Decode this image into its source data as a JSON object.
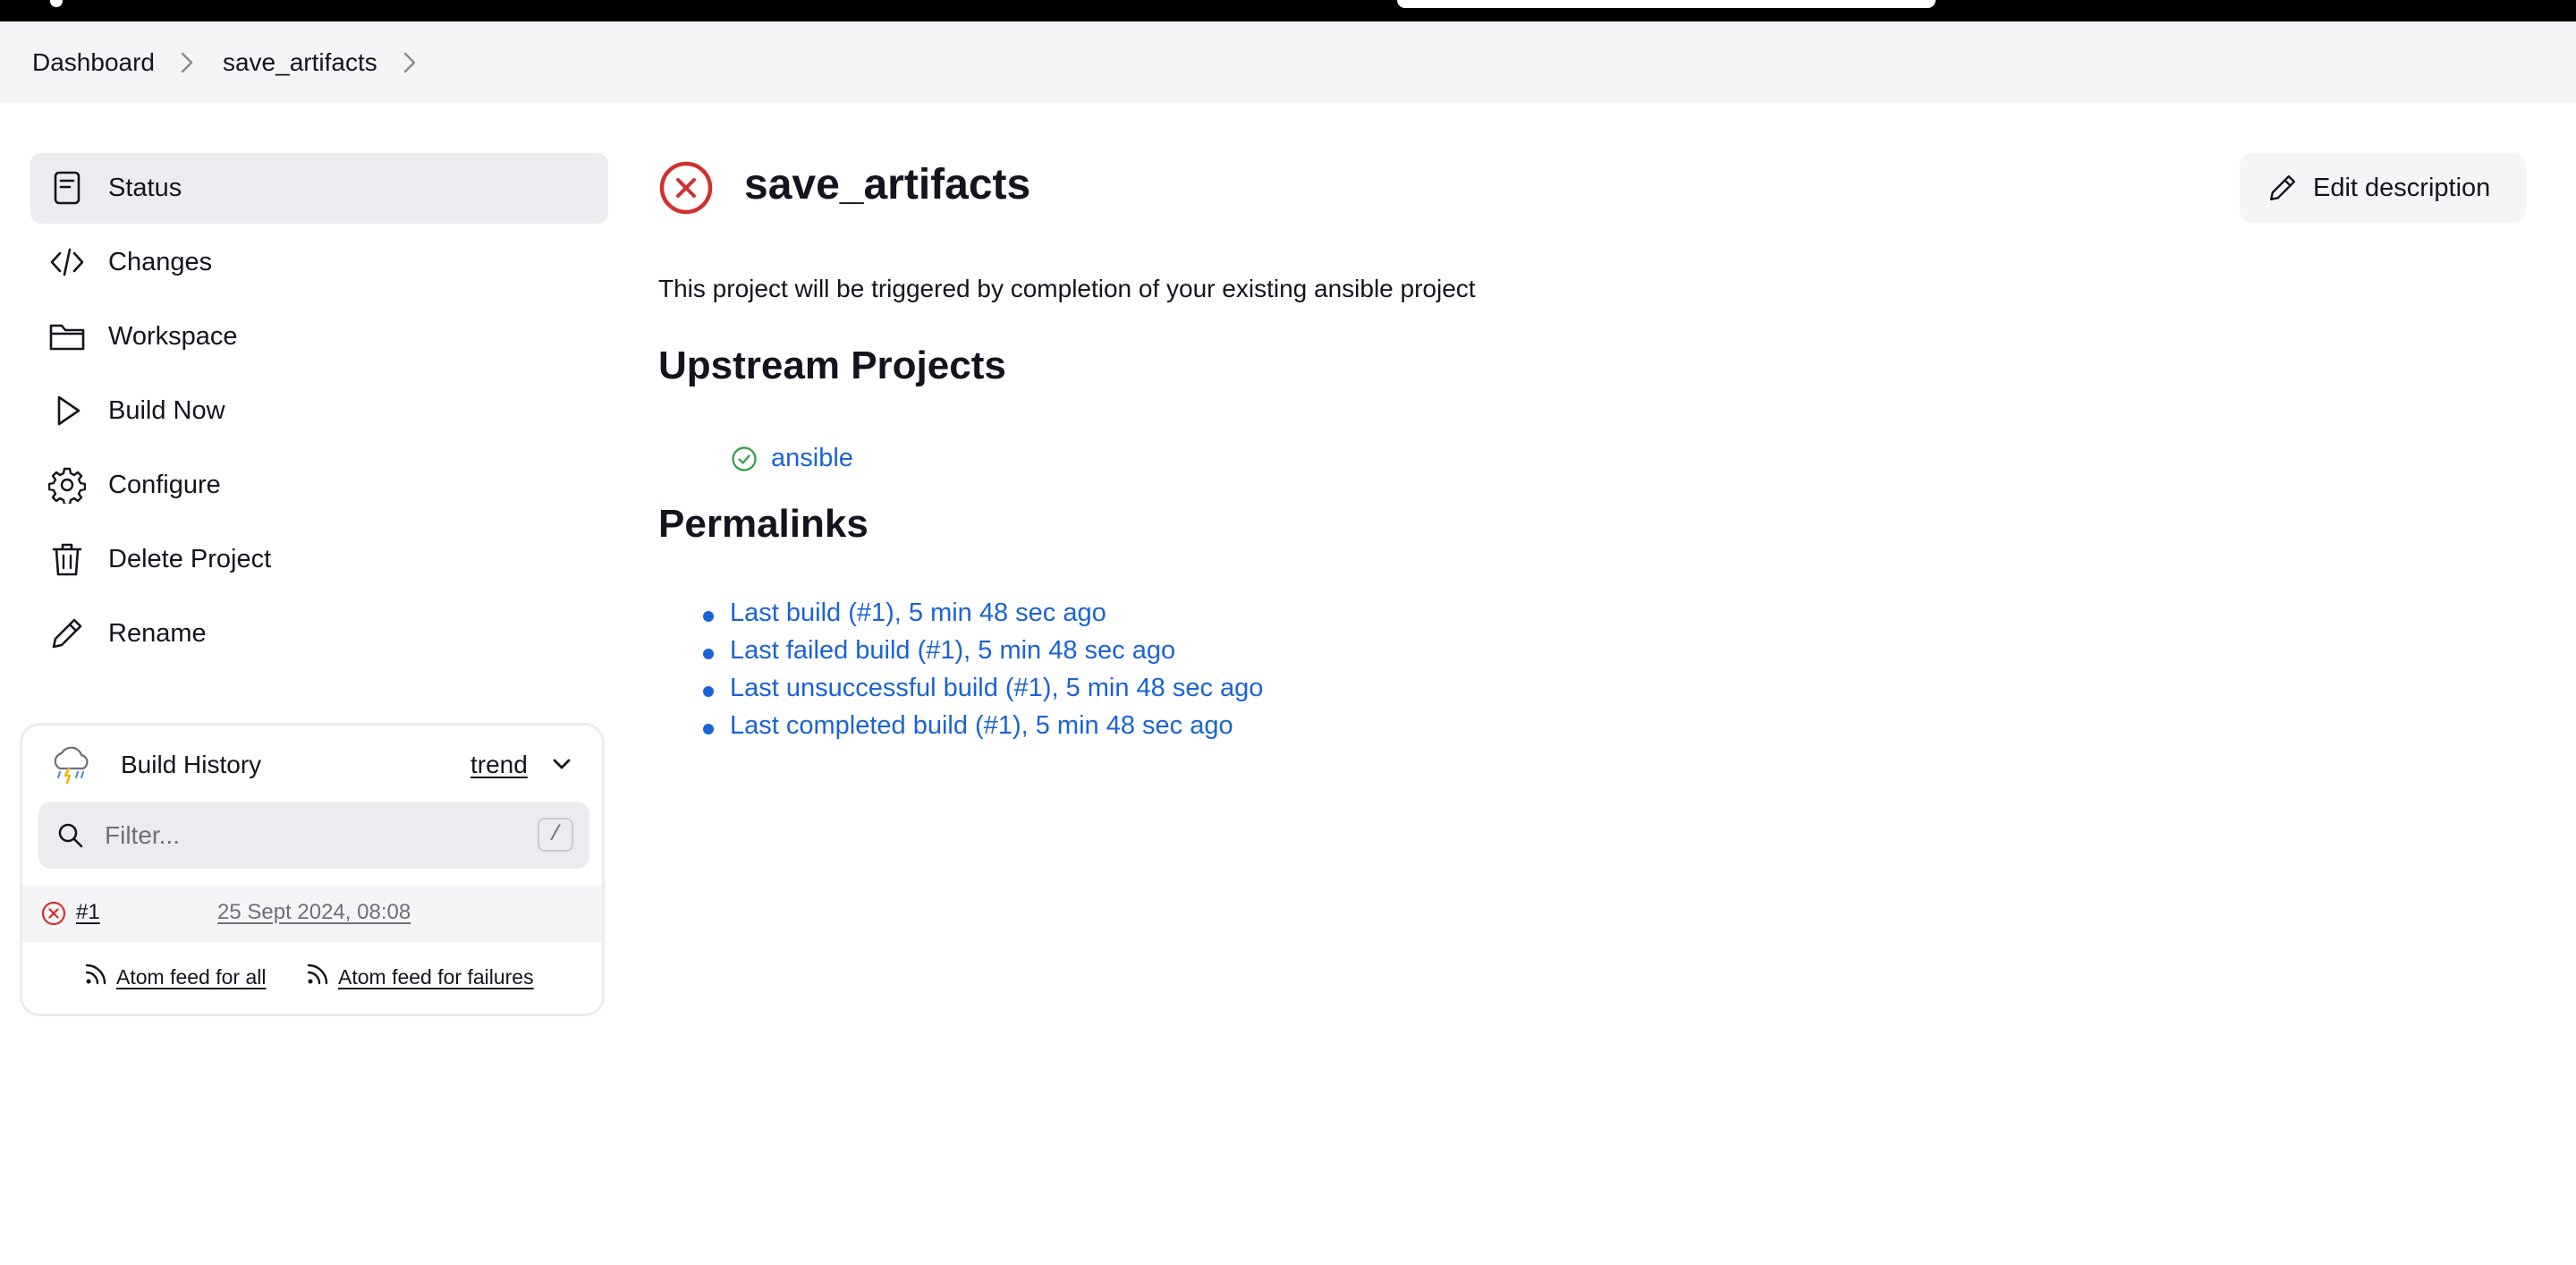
{
  "breadcrumb": {
    "items": [
      "Dashboard",
      "save_artifacts"
    ]
  },
  "sidebar": {
    "items": [
      {
        "label": "Status",
        "icon": "status-icon"
      },
      {
        "label": "Changes",
        "icon": "code-icon"
      },
      {
        "label": "Workspace",
        "icon": "folder-icon"
      },
      {
        "label": "Build Now",
        "icon": "play-icon"
      },
      {
        "label": "Configure",
        "icon": "gear-icon"
      },
      {
        "label": "Delete Project",
        "icon": "trash-icon"
      },
      {
        "label": "Rename",
        "icon": "pencil-icon"
      }
    ]
  },
  "build_history": {
    "title": "Build History",
    "trend": "trend",
    "filter_placeholder": "Filter...",
    "filter_shortcut": "/",
    "builds": [
      {
        "number": "#1",
        "date": "25 Sept 2024, 08:08",
        "status": "failed"
      }
    ],
    "feed_all": "Atom feed for all",
    "feed_failures": "Atom feed for failures"
  },
  "main": {
    "title": "save_artifacts",
    "status": "failed",
    "edit_description": "Edit description",
    "description": "This project will be triggered by completion of your existing ansible project",
    "upstream_heading": "Upstream Projects",
    "upstream": [
      {
        "name": "ansible",
        "status": "success"
      }
    ],
    "permalinks_heading": "Permalinks",
    "permalinks": [
      "Last build (#1), 5 min 48 sec ago",
      "Last failed build (#1), 5 min 48 sec ago",
      "Last unsuccessful build (#1), 5 min 48 sec ago",
      "Last completed build (#1), 5 min 48 sec ago"
    ]
  },
  "colors": {
    "link": "#1a63d6",
    "failure": "#d32f2f",
    "success": "#2e9e44",
    "sidebar_active": "#ececf0"
  }
}
